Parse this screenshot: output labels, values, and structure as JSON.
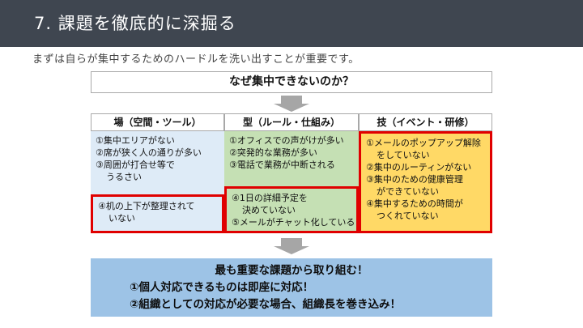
{
  "slide": {
    "title": "7. 課題を徹底的に深掘る",
    "subtitle": "まずは自らが集中するためのハードルを洗い出すことが重要です。",
    "question": "なぜ集中できないのか？"
  },
  "columns": [
    {
      "header": "場（空間・ツール）",
      "top_lines": [
        "①集中エリアがない",
        "②席が狭く人の通りが多い",
        "③周囲が打合せ等で",
        "うるさい"
      ],
      "bottom_lines": [
        "④机の上下が整理されて",
        "いない"
      ]
    },
    {
      "header": "型（ルール・仕組み）",
      "top_lines": [
        "①オフィスでの声がけが多い",
        "②突発的な業務が多い",
        "③電話で業務が中断される"
      ],
      "bottom_lines": [
        "④1日の詳細予定を",
        "決めていない",
        "⑤メールがチャット化している"
      ]
    },
    {
      "header": "技（イベント・研修）",
      "lines": [
        "①メールのポップアップ解除",
        "をしていない",
        "②集中のルーティンがない",
        "③集中のための健康管理",
        "ができていない",
        "④集中するための時間が",
        "つくれていない"
      ]
    }
  ],
  "conclusion": {
    "line1": "最も重要な課題から取り組む！",
    "line2": "①個人対応できるものは即座に対応！",
    "line3": "②組織としての対応が必要な場合、組織長を巻き込み！"
  },
  "colors": {
    "header_bg": "#3f4650",
    "col1_bg": "#deebf7",
    "col2_bg": "#c5e0b4",
    "col3_bg": "#ffd966",
    "highlight_border": "#e00000",
    "conclusion_bg": "#9dc3e6"
  }
}
